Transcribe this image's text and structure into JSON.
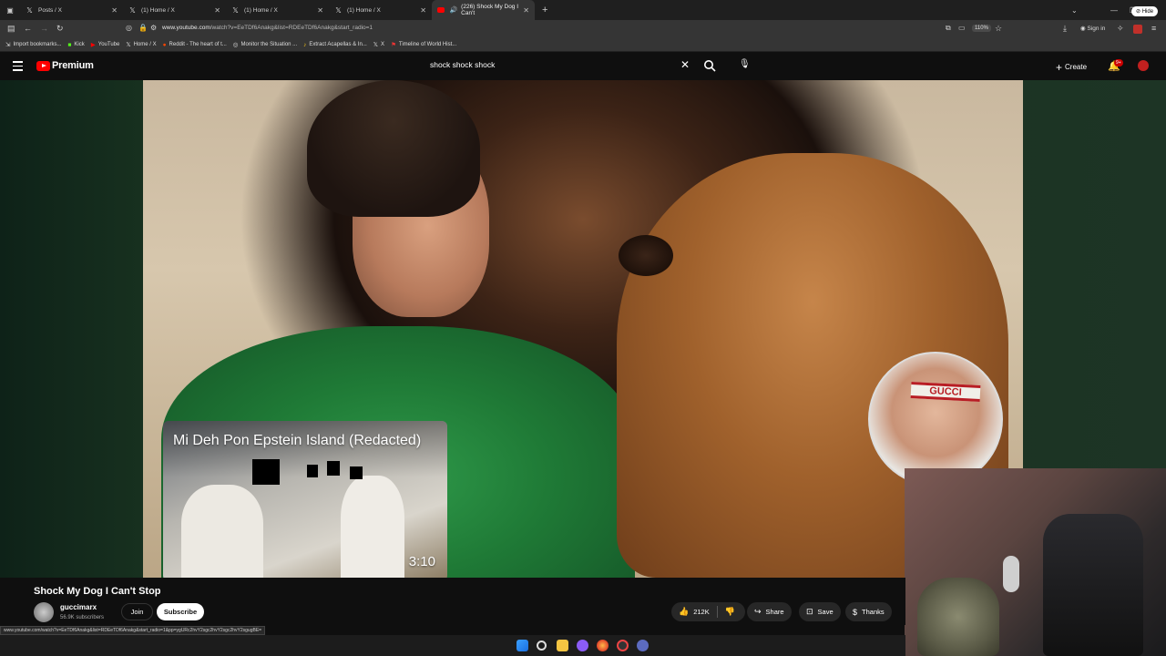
{
  "browser": {
    "tabs": [
      {
        "label": "Posts / X",
        "icon": "x-logo-icon"
      },
      {
        "label": "(1) Home / X",
        "icon": "x-logo-icon"
      },
      {
        "label": "(1) Home / X",
        "icon": "x-logo-icon"
      },
      {
        "label": "(1) Home / X",
        "icon": "x-logo-icon"
      },
      {
        "label": "(226) Shock My Dog I Can't",
        "icon": "youtube-icon"
      }
    ],
    "url_host": "www.youtube.com",
    "url_rest": "/watch?v=EeTDf6Anakg&list=RDEeTDf6Anakg&start_radio=1",
    "zoom": "110%",
    "signin": "Sign in",
    "bookmarks": [
      {
        "label": "Import bookmarks...",
        "icon": "import-icon"
      },
      {
        "label": "Kick",
        "icon": "kick-icon"
      },
      {
        "label": "YouTube",
        "icon": "youtube-icon"
      },
      {
        "label": "Home / X",
        "icon": "x-logo-icon"
      },
      {
        "label": "Reddit - The heart of t...",
        "icon": "reddit-icon"
      },
      {
        "label": "Monitor the Situation ...",
        "icon": "monitor-icon"
      },
      {
        "label": "Extract Acapellas & In...",
        "icon": "music-icon"
      },
      {
        "label": "X",
        "icon": "x-logo-icon"
      },
      {
        "label": "Timeline of World Hist...",
        "icon": "flag-icon"
      }
    ]
  },
  "youtube": {
    "brand": "Premium",
    "search_query": "shock shock shock",
    "create_label": "Create",
    "notif_count": "9+",
    "hide_label": "Hide"
  },
  "overlay_card": {
    "title": "Mi Deh Pon Epstein Island (Redacted)",
    "duration": "3:10"
  },
  "video": {
    "title": "Shock My Dog I Can't Stop",
    "channel": "guccimarx",
    "subscribers": "56.9K subscribers",
    "join": "Join",
    "subscribe": "Subscribe",
    "likes": "212K",
    "share": "Share",
    "save": "Save",
    "thanks": "Thanks"
  },
  "webcam": {
    "headband_text": "GUCCI"
  },
  "status_url": "www.youtube.com/watch?v=EeTDf6Anakg&list=RDEeTDf6Anakg&start_radio=1&pp=ygURc2hvY2sgc2hvY2sgc2hvY2sgugBE=",
  "colors": {
    "youtube_red": "#ff0000",
    "subscribe_bg": "#ffffff",
    "pill_bg": "#272727",
    "headband_red": "#b81d24"
  }
}
